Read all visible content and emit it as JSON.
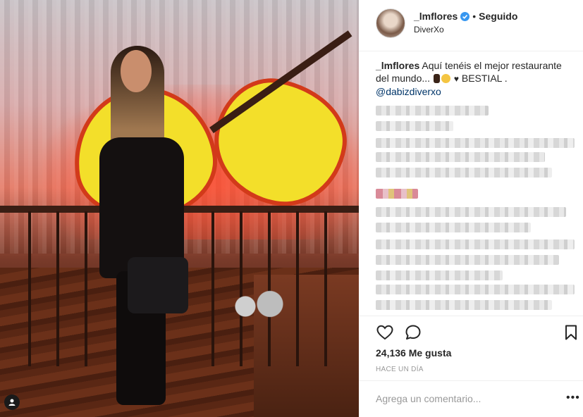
{
  "post": {
    "username": "_lmflores",
    "follow_status": "Seguido",
    "separator": "•",
    "location": "DiverXo",
    "caption": {
      "username": "_lmflores",
      "text_part1": "Aquí tenéis el mejor restaurante del mundo...",
      "text_part2": "BESTIAL .",
      "mention": "@dabizdiverxo"
    },
    "likes": "24,136 Me gusta",
    "timestamp": "HACE UN DÍA",
    "comment_placeholder": "Agrega un comentario...",
    "more_label": "•••"
  },
  "colors": {
    "verified": "#3897f0",
    "link": "#003569",
    "border": "#efefef"
  },
  "icons": {
    "like": "heart-icon",
    "comment": "comment-icon",
    "save": "bookmark-icon",
    "verified": "verified-badge-icon",
    "multi": "user-tag-icon"
  }
}
